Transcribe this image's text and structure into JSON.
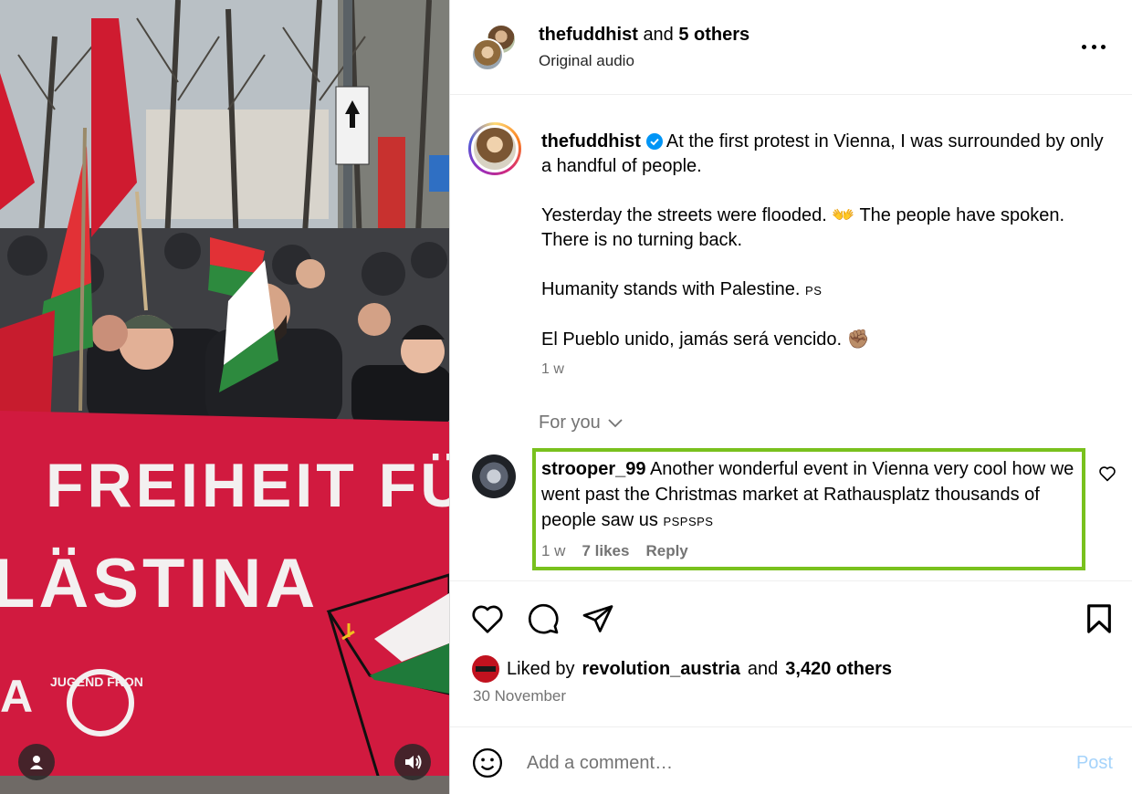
{
  "media": {
    "banner_line1": "FREIHEIT FÜ",
    "banner_line2": "LÄSTINA",
    "banner_logo_text": "JUGEND FRON",
    "tag_icon": "person-icon",
    "audio_icon": "speaker-icon"
  },
  "header": {
    "author": "thefuddhist",
    "joiner": "and",
    "others": "5 others",
    "audio": "Original audio"
  },
  "caption": {
    "username": "thefuddhist",
    "line1": "At the first protest in Vienna, I was surrounded by only a handful of people.",
    "line2": "Yesterday the streets were flooded. 👐 The people have spoken. There is no turning back.",
    "line3_text": "Humanity stands with Palestine.",
    "line3_flag": "PS",
    "line4": "El Pueblo unido, jamás será vencido. ✊🏽",
    "time": "1 w"
  },
  "for_you": "For you",
  "comment": {
    "username": "strooper_99",
    "text": "Another wonderful event in Vienna very cool how we went past the Christmas market at Rathausplatz thousands of people saw us",
    "flags": "PSPSPS",
    "time": "1 w",
    "likes": "7 likes",
    "reply": "Reply"
  },
  "likes": {
    "prefix": "Liked by",
    "user": "revolution_austria",
    "joiner": "and",
    "count": "3,420 others"
  },
  "date": "30 November",
  "add_comment": {
    "placeholder": "Add a comment…",
    "post": "Post"
  },
  "colors": {
    "highlight": "#79c11d",
    "verified": "#0095f6",
    "post_disabled": "#a5d3fb",
    "banner_red": "#d11a3f"
  }
}
